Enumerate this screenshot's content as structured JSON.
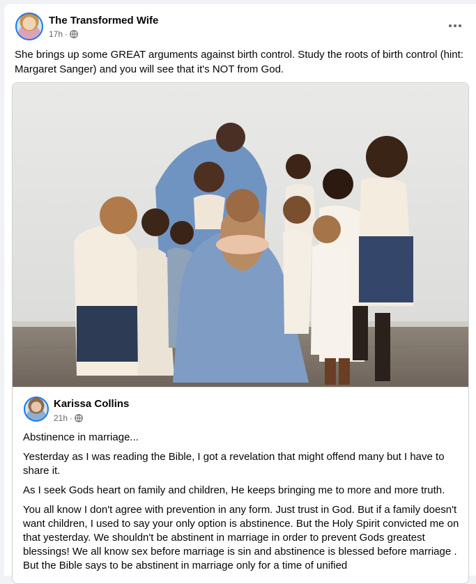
{
  "post": {
    "author": "The Transformed Wife",
    "time": "17h",
    "text": "She brings up some GREAT arguments against birth control. Study the roots of birth control (hint: Margaret Sanger) and you will see that it's NOT from God."
  },
  "shared_post": {
    "author": "Karissa Collins",
    "time": "21h",
    "paragraphs": [
      "Abstinence in marriage...",
      "Yesterday as I was reading the Bible, I got a revelation that might offend many but I have to share it.",
      "As I seek Gods heart on family and children, He keeps bringing me to more and more truth.",
      "You all know I don't agree with prevention in any form. Just trust in God. But if a family doesn't want children, I used to say your only option is abstinence. But the Holy Spirit convicted me on that yesterday. We shouldn't be abstinent in marriage in order to prevent Gods greatest blessings! We all know sex before marriage is sin and abstinence is blessed before marriage . But the Bible says to be abstinent in marriage only for a time of unified"
    ]
  },
  "icons": {
    "audience": "globe-icon",
    "menu": "more-options-icon"
  },
  "colors": {
    "accent": "#1877f2",
    "secondary_text": "#65676b",
    "dress_blue": "#7f9dc4"
  }
}
